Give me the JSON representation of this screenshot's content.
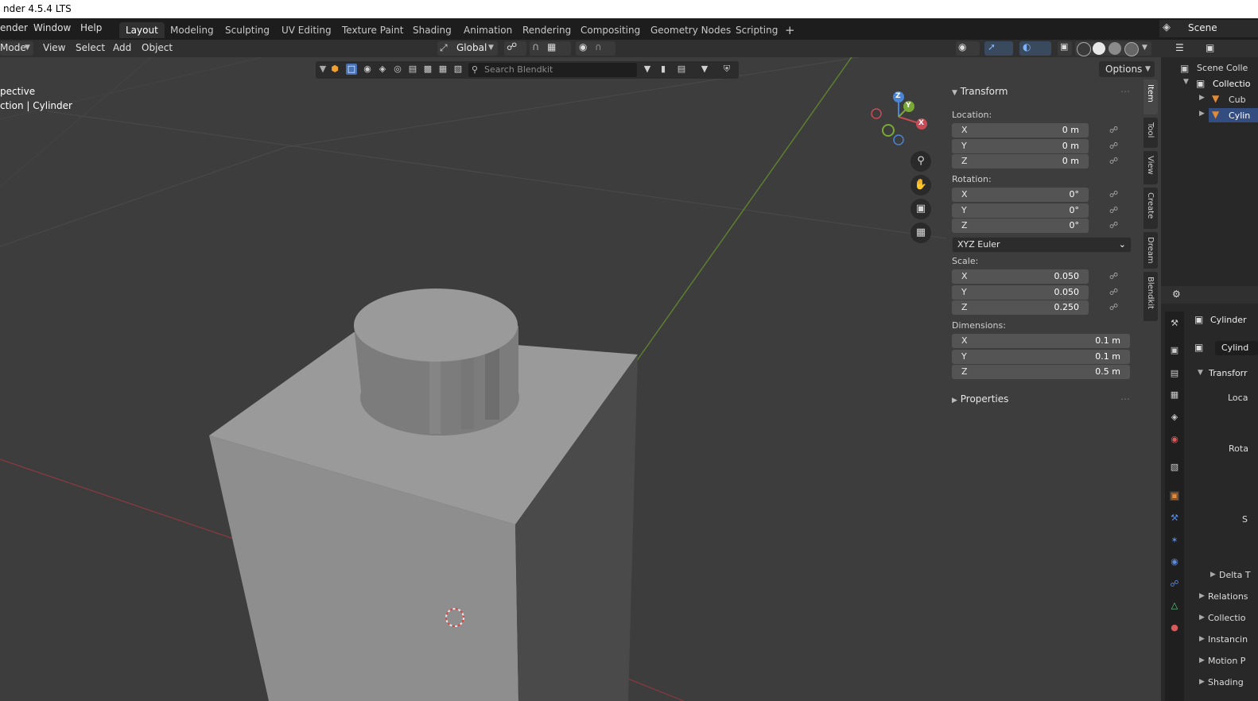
{
  "titlebar": {
    "title": "nder 4.5.4 LTS"
  },
  "menubar": {
    "items": [
      "ender",
      "Window",
      "Help"
    ],
    "workspaces": [
      "Layout",
      "Modeling",
      "Sculpting",
      "UV Editing",
      "Texture Paint",
      "Shading",
      "Animation",
      "Rendering",
      "Compositing",
      "Geometry Nodes",
      "Scripting"
    ],
    "active_workspace": "Layout",
    "add_tab": "+",
    "scene_label": "Scene"
  },
  "vp_header": {
    "mode": "Mode",
    "menus": [
      "View",
      "Select",
      "Add",
      "Object"
    ],
    "orientation": "Global"
  },
  "blendkit": {
    "search_placeholder": "Search Blendkit"
  },
  "options_label": "Options",
  "viewport": {
    "view_name": "pective",
    "collection_object": "ction | Cylinder",
    "gizmo": {
      "x": "X",
      "y": "Y",
      "z": "Z"
    }
  },
  "npanel": {
    "transform_title": "Transform",
    "location_label": "Location:",
    "location": [
      {
        "axis": "X",
        "value": "0 m"
      },
      {
        "axis": "Y",
        "value": "0 m"
      },
      {
        "axis": "Z",
        "value": "0 m"
      }
    ],
    "rotation_label": "Rotation:",
    "rotation": [
      {
        "axis": "X",
        "value": "0°"
      },
      {
        "axis": "Y",
        "value": "0°"
      },
      {
        "axis": "Z",
        "value": "0°"
      }
    ],
    "rotation_mode": "XYZ Euler",
    "scale_label": "Scale:",
    "scale": [
      {
        "axis": "X",
        "value": "0.050"
      },
      {
        "axis": "Y",
        "value": "0.050"
      },
      {
        "axis": "Z",
        "value": "0.250"
      }
    ],
    "dimensions_label": "Dimensions:",
    "dimensions": [
      {
        "axis": "X",
        "value": "0.1 m"
      },
      {
        "axis": "Y",
        "value": "0.1 m"
      },
      {
        "axis": "Z",
        "value": "0.5 m"
      }
    ],
    "properties_title": "Properties",
    "tabs": [
      "Item",
      "Tool",
      "View",
      "Create",
      "Dream",
      "Blendkit"
    ]
  },
  "outliner": {
    "scene_collection": "Scene Colle",
    "collection": "Collectio",
    "items": [
      "Cub",
      "Cylin"
    ]
  },
  "properties": {
    "object_name": "Cylinder",
    "data_name": "Cylind",
    "sections": [
      "Transforr",
      "Loca",
      "Rota",
      "S",
      "Delta T",
      "Relations",
      "Collectio",
      "Instancin",
      "Motion P",
      "Shading"
    ]
  },
  "colors": {
    "x_axis": "#c94b55",
    "y_axis": "#79a834",
    "z_axis": "#4a84d2",
    "viewport_bg": "#3d3d3d",
    "mesh": "#9b9b9b"
  }
}
